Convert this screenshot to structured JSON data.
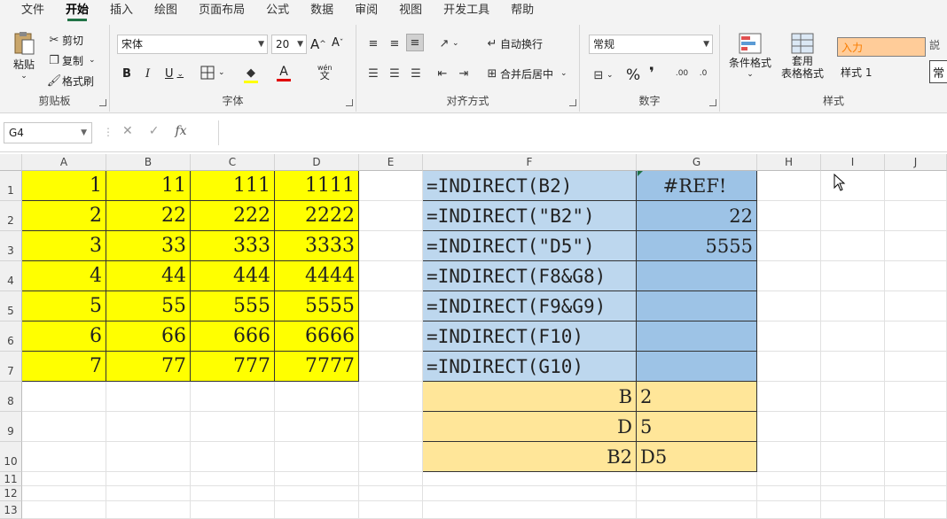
{
  "tabs": [
    "文件",
    "开始",
    "插入",
    "绘图",
    "页面布局",
    "公式",
    "数据",
    "审阅",
    "视图",
    "开发工具",
    "帮助"
  ],
  "active_tab": "开始",
  "ribbon": {
    "clipboard": {
      "label": "剪贴板",
      "paste": "粘贴",
      "cut": "剪切",
      "copy": "复制",
      "format_painter": "格式刷"
    },
    "font": {
      "label": "字体",
      "font_name": "宋体",
      "font_size": "20",
      "bold": "B",
      "italic": "I",
      "underline": "U",
      "grow": "A",
      "shrink": "A",
      "font_color": "A",
      "phonetic": "wén"
    },
    "alignment": {
      "label": "对齐方式",
      "wrap": "自动换行",
      "merge": "合并后居中"
    },
    "number": {
      "label": "数字",
      "format": "常规",
      "percent": "%",
      "comma": "❜"
    },
    "styles": {
      "label": "样式",
      "conditional": "条件格式",
      "table_fmt_1": "套用",
      "table_fmt_2": "表格格式",
      "style_input": "入力",
      "style_1": "样式 1",
      "style_partial": "常",
      "style_partial2": "説"
    }
  },
  "namebox": "G4",
  "fx": "fx",
  "columns": [
    "A",
    "B",
    "C",
    "D",
    "E",
    "F",
    "G",
    "H",
    "I",
    "J"
  ],
  "rows": [
    "1",
    "2",
    "3",
    "4",
    "5",
    "6",
    "7",
    "8",
    "9",
    "10",
    "11",
    "12",
    "13"
  ],
  "yellow_values": [
    [
      "1",
      "11",
      "111",
      "1111"
    ],
    [
      "2",
      "22",
      "222",
      "2222"
    ],
    [
      "3",
      "33",
      "333",
      "3333"
    ],
    [
      "4",
      "44",
      "444",
      "4444"
    ],
    [
      "5",
      "55",
      "555",
      "5555"
    ],
    [
      "6",
      "66",
      "666",
      "6666"
    ],
    [
      "7",
      "77",
      "777",
      "7777"
    ]
  ],
  "formulas": [
    "=INDIRECT(B2)",
    "=INDIRECT(\"B2\")",
    "=INDIRECT(\"D5\")",
    "=INDIRECT(F8&G8)",
    "=INDIRECT(F9&G9)",
    "=INDIRECT(F10)",
    "=INDIRECT(G10)"
  ],
  "results": [
    "#REF!",
    "22",
    "5555",
    "",
    "",
    "",
    ""
  ],
  "ref_rows": [
    [
      "B",
      "2"
    ],
    [
      "D",
      "5"
    ],
    [
      "B2",
      "D5"
    ]
  ],
  "colors": {
    "yellow": "#ffff00",
    "blue_light": "#bdd7ee",
    "blue_dark": "#9dc3e6",
    "orange": "#ffe699",
    "accent": "#217346"
  }
}
